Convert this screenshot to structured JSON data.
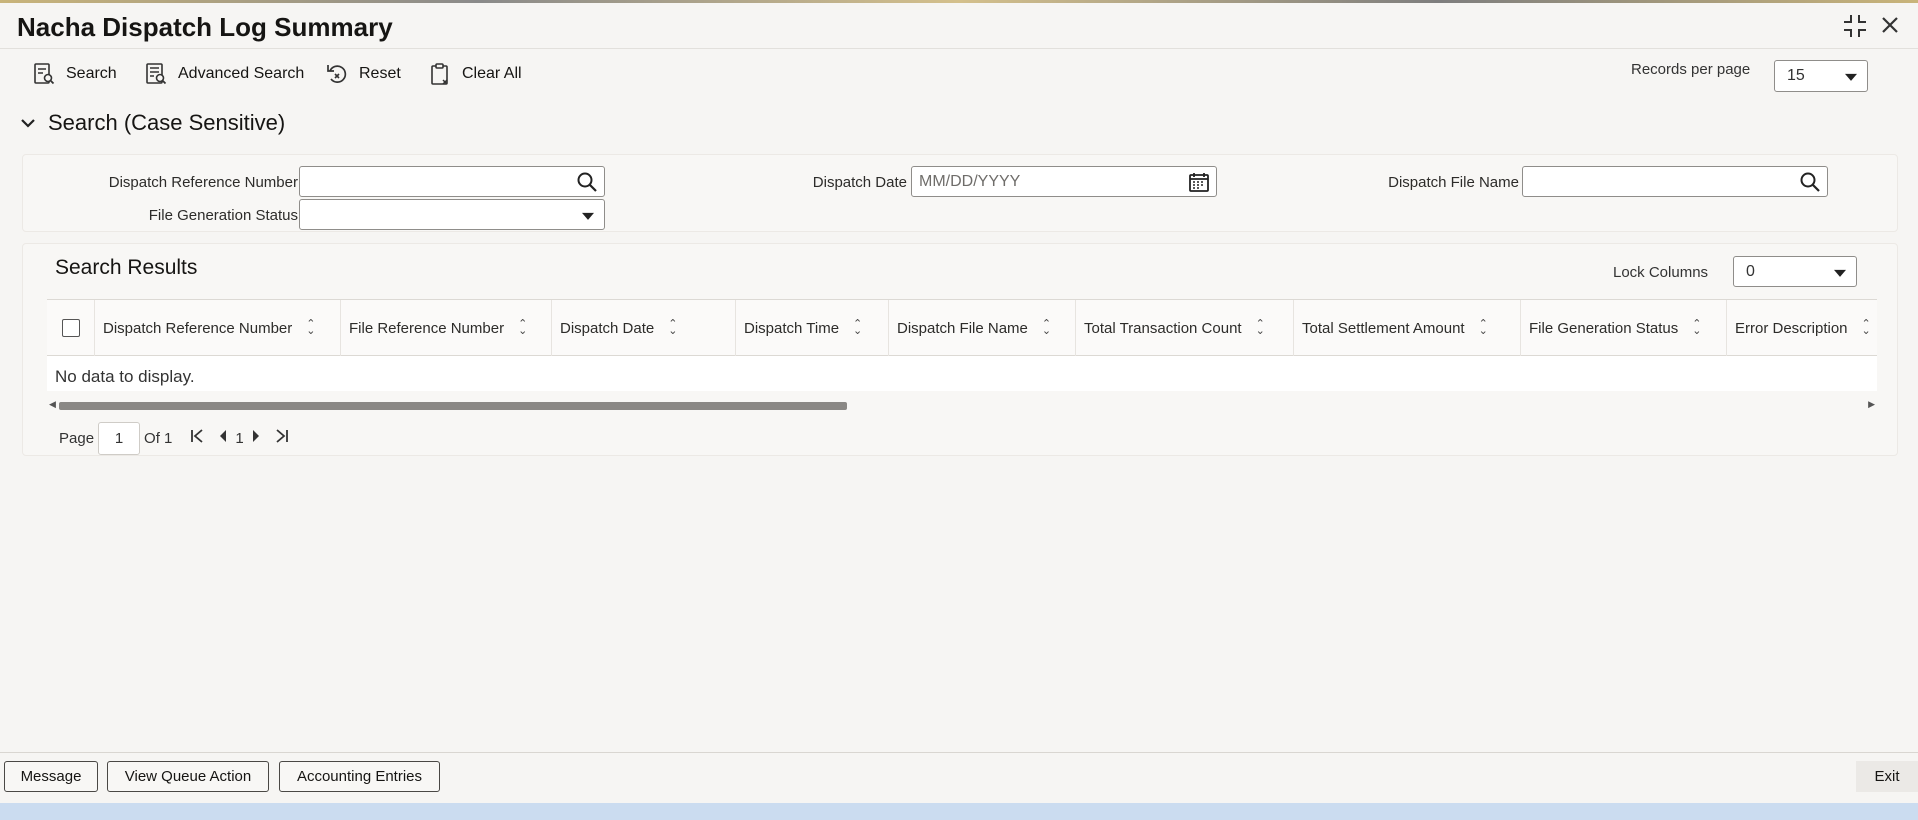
{
  "window": {
    "title": "Nacha Dispatch Log Summary",
    "restore_icon": "restore-window-icon",
    "close_icon": "close-icon"
  },
  "toolbar": {
    "search_label": "Search",
    "advanced_search_label": "Advanced Search",
    "reset_label": "Reset",
    "clear_all_label": "Clear All",
    "records_per_page_label": "Records per page",
    "records_per_page_value": "15"
  },
  "search_section": {
    "heading": "Search (Case Sensitive)",
    "fields": {
      "dispatch_reference_number": {
        "label": "Dispatch Reference Number",
        "value": ""
      },
      "dispatch_date": {
        "label": "Dispatch Date",
        "placeholder": "MM/DD/YYYY"
      },
      "dispatch_file_name": {
        "label": "Dispatch File Name",
        "value": ""
      },
      "file_generation_status": {
        "label": "File Generation Status",
        "value": ""
      }
    }
  },
  "results": {
    "title": "Search Results",
    "lock_columns_label": "Lock Columns",
    "lock_columns_value": "0",
    "columns": [
      "Dispatch Reference Number",
      "File Reference Number",
      "Dispatch Date",
      "Dispatch Time",
      "Dispatch File Name",
      "Total Transaction Count",
      "Total Settlement Amount",
      "File Generation Status",
      "Error Description"
    ],
    "empty_message": "No data to display.",
    "pagination": {
      "page_label": "Page",
      "current_page": "1",
      "of_label": "Of 1",
      "page_number_link": "1"
    }
  },
  "footer": {
    "message_label": "Message",
    "view_queue_action_label": "View Queue Action",
    "accounting_entries_label": "Accounting Entries",
    "exit_label": "Exit"
  }
}
